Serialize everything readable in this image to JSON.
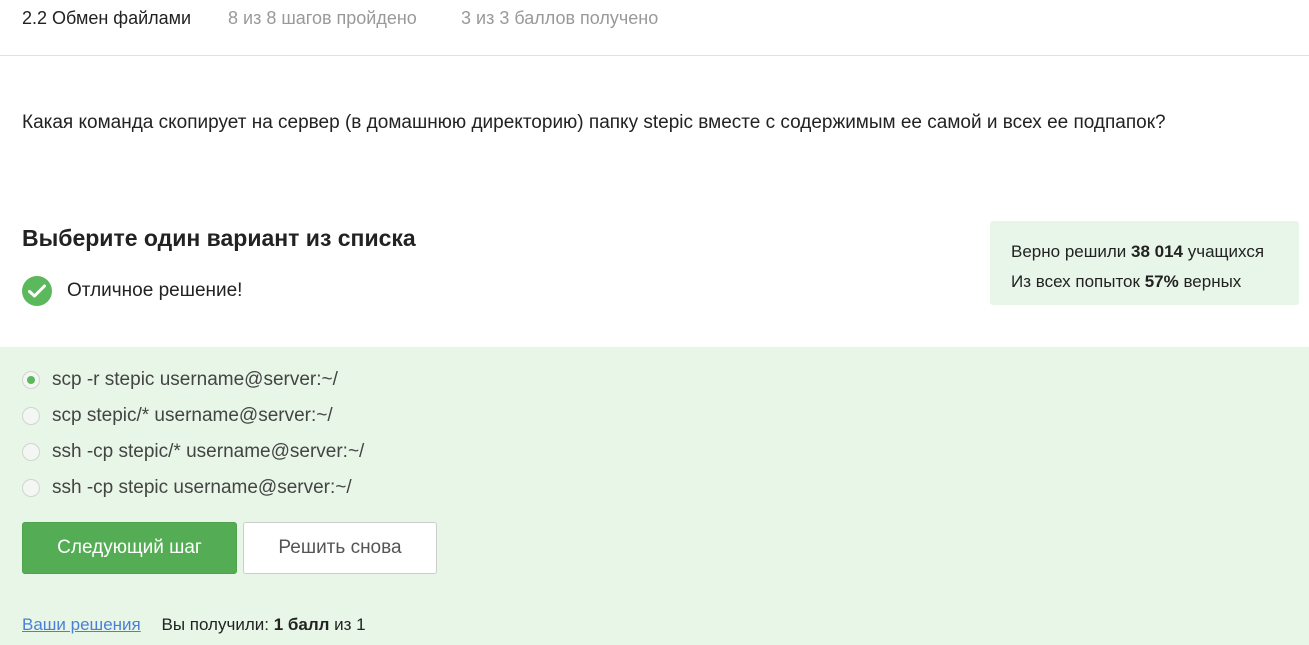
{
  "header": {
    "step_title": "2.2 Обмен файлами",
    "steps_progress": "8 из 8 шагов пройдено",
    "points_progress": "3 из 3 баллов  получено"
  },
  "question": "Какая команда скопирует на сервер (в домашнюю директорию) папку stepic вместе с содержимым ее самой и всех ее подпапок?",
  "choice": {
    "title": "Выберите один вариант из списка",
    "feedback": "Отличное решение!",
    "feedback_icon": "check-circle-icon",
    "options": [
      {
        "label": "scp -r stepic username@server:~/",
        "selected": true
      },
      {
        "label": "scp stepic/* username@server:~/",
        "selected": false
      },
      {
        "label": "ssh -cp stepic/* username@server:~/",
        "selected": false
      },
      {
        "label": "ssh -cp stepic username@server:~/",
        "selected": false
      }
    ]
  },
  "stats": {
    "solved_prefix": "Верно решили",
    "solved_count": "38 014",
    "solved_suffix": "учащихся",
    "attempts_prefix": "Из всех попыток",
    "attempts_percent": "57%",
    "attempts_suffix": "верных"
  },
  "buttons": {
    "next": "Следующий шаг",
    "retry": "Решить снова"
  },
  "footer": {
    "solutions_link": "Ваши решения",
    "result_prefix": "Вы получили:",
    "result_value": "1 балл",
    "result_suffix": "из 1"
  },
  "colors": {
    "accent_green": "#54ad54",
    "success_bg": "#e8f6e7",
    "link_blue": "#4a80d6"
  }
}
